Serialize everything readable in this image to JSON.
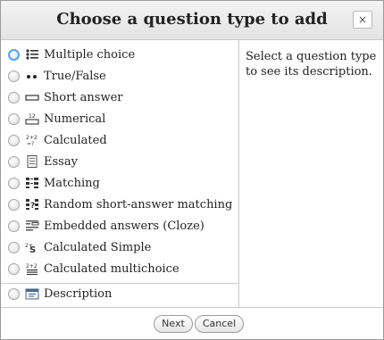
{
  "dialog": {
    "title": "Choose a question type to add",
    "close_label": "×"
  },
  "options": [
    {
      "label": "Multiple choice",
      "icon": "multiple-choice-icon",
      "selected": true
    },
    {
      "label": "True/False",
      "icon": "true-false-icon",
      "selected": false
    },
    {
      "label": "Short answer",
      "icon": "short-answer-icon",
      "selected": false
    },
    {
      "label": "Numerical",
      "icon": "numerical-icon",
      "selected": false
    },
    {
      "label": "Calculated",
      "icon": "calculated-icon",
      "selected": false
    },
    {
      "label": "Essay",
      "icon": "essay-icon",
      "selected": false
    },
    {
      "label": "Matching",
      "icon": "matching-icon",
      "selected": false
    },
    {
      "label": "Random short-answer matching",
      "icon": "random-matching-icon",
      "selected": false
    },
    {
      "label": "Embedded answers (Cloze)",
      "icon": "cloze-icon",
      "selected": false
    },
    {
      "label": "Calculated Simple",
      "icon": "calculated-simple-icon",
      "selected": false
    },
    {
      "label": "Calculated multichoice",
      "icon": "calculated-multichoice-icon",
      "selected": false
    },
    {
      "label": "Description",
      "icon": "description-icon",
      "selected": false
    }
  ],
  "description": {
    "text": "Select a question type to see its description."
  },
  "footer": {
    "next_label": "Next",
    "cancel_label": "Cancel"
  },
  "colors": {
    "selected_radio": "#5aa0e8",
    "border": "#c9c9c9"
  }
}
